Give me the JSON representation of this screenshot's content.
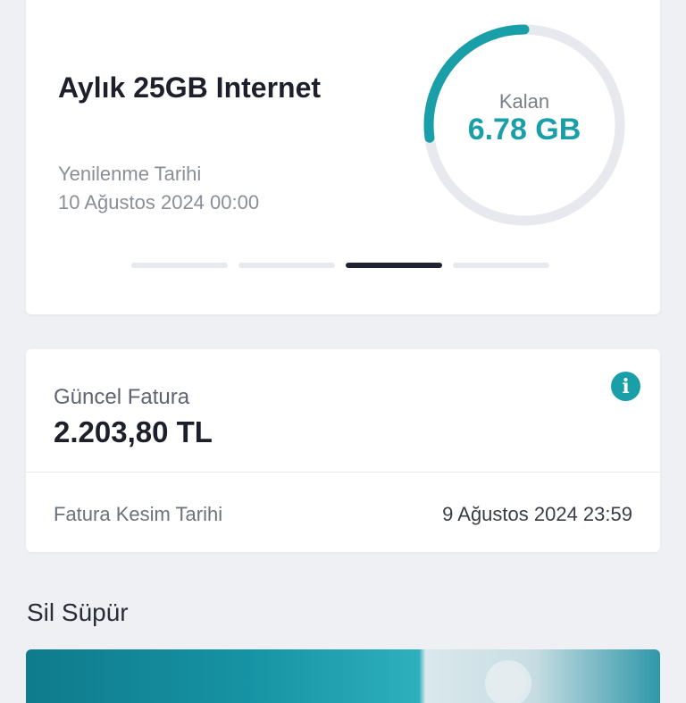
{
  "package": {
    "title": "Aylık 25GB Internet",
    "renewal_label": "Yenilenme Tarihi",
    "renewal_date": "10 Ağustos 2024 00:00",
    "gauge": {
      "label": "Kalan",
      "value_text": "6.78 GB",
      "remaining_fraction": 0.2712
    },
    "carousel": {
      "pages": 4,
      "active_index": 2
    }
  },
  "bill": {
    "label": "Güncel Fatura",
    "amount": "2.203,80 TL",
    "cut_label": "Fatura Kesim Tarihi",
    "cut_date": "9 Ağustos 2024 23:59"
  },
  "section": {
    "title": "Sil Süpür"
  },
  "colors": {
    "accent": "#1a9fa8",
    "gauge_track": "#e7e9ee",
    "text_dark": "#1d1f2b"
  },
  "icons": {
    "info": "info-icon"
  }
}
